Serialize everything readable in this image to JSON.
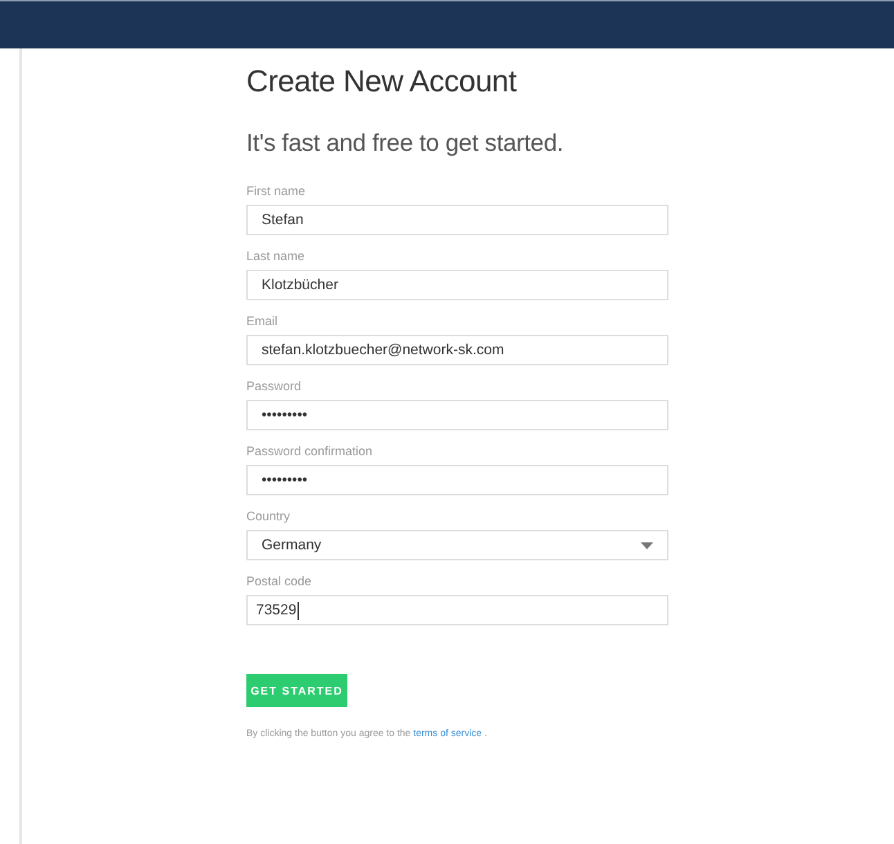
{
  "title": "Create New Account",
  "subtitle": "It's fast and free to get started.",
  "fields": [
    {
      "kind": "text",
      "label": "First name",
      "value": "Stefan"
    },
    {
      "kind": "text",
      "label": "Last name",
      "value": "Klotzbücher"
    },
    {
      "kind": "text",
      "label": "Email",
      "value": "stefan.klotzbuecher@network-sk.com"
    },
    {
      "kind": "text",
      "label": "Password",
      "value": "•••••••••"
    },
    {
      "kind": "text",
      "label": "Password confirmation",
      "value": "•••••••••"
    },
    {
      "kind": "select",
      "label": "Country",
      "value": "Germany"
    },
    {
      "kind": "text",
      "label": "Postal code",
      "value": "73529",
      "focused": true
    }
  ],
  "button": "GET STARTED",
  "terms": {
    "before": "By clicking the button you agree to the ",
    "link": "terms of service",
    "after": " ."
  }
}
